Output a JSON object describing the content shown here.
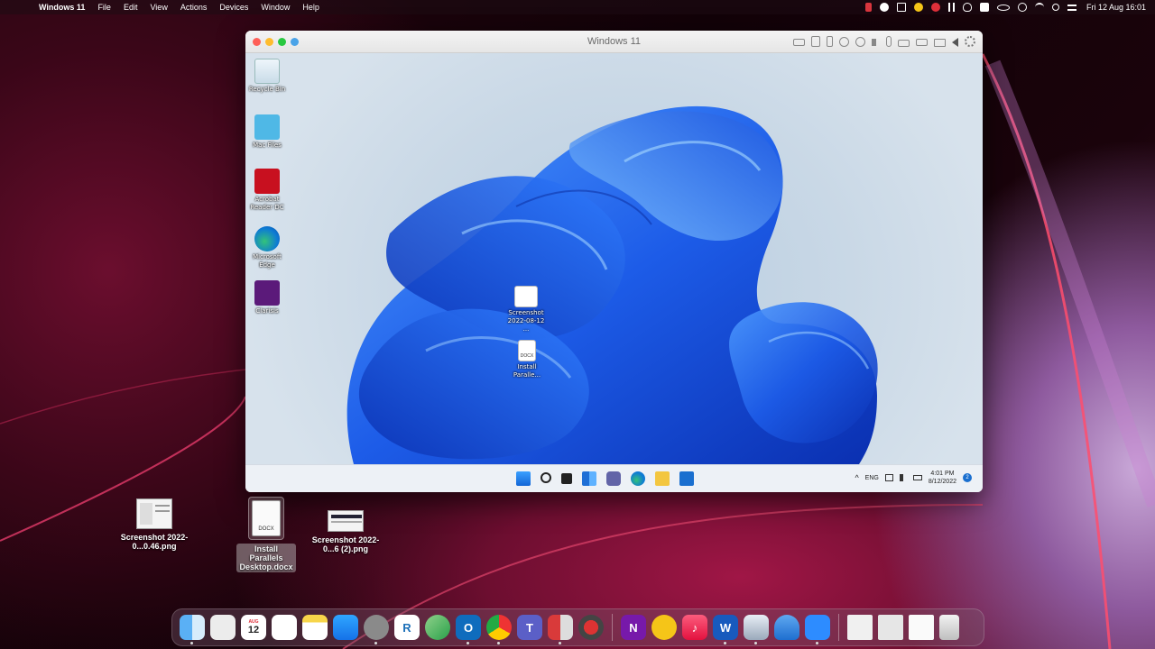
{
  "menubar": {
    "app_name": "Windows 11",
    "items": [
      "File",
      "Edit",
      "View",
      "Actions",
      "Devices",
      "Window",
      "Help"
    ],
    "clock": "Fri 12 Aug  16:01"
  },
  "vm_window": {
    "title": "Windows 11"
  },
  "windows_desktop": {
    "icons": [
      {
        "label": "Recycle Bin"
      },
      {
        "label": "Mac Files"
      },
      {
        "label": "Acrobat Reader DC"
      },
      {
        "label": "Microsoft Edge"
      },
      {
        "label": "Clarisis"
      }
    ],
    "files": [
      {
        "label": "Screenshot 2022-08-12 ..."
      },
      {
        "label": "Install Paralle..."
      }
    ],
    "taskbar": {
      "lang": "ENG",
      "time": "4:01 PM",
      "date": "8/12/2022",
      "notification_count": "2"
    },
    "docx_tag": "DOCX"
  },
  "mac_desktop": {
    "files": [
      {
        "label": "Screenshot 2022-0...0.46.png"
      },
      {
        "label": "Install Parallels Desktop.docx",
        "tag": "DOCX"
      },
      {
        "label": "Screenshot 2022-0...6 (2).png"
      }
    ]
  },
  "dock": {
    "calendar_month": "AUG",
    "calendar_day": "12",
    "icons": [
      "finder-icon",
      "launchpad-icon",
      "calendar-icon",
      "reminders-icon",
      "notes-icon",
      "app-store-icon",
      "system-preferences-icon",
      "rstudio-icon",
      "maps-icon",
      "outlook-icon",
      "chrome-icon",
      "teams-icon",
      "parallels-icon",
      "cherry-icon",
      "onenote-icon",
      "cyberduck-icon",
      "music-icon",
      "word-icon",
      "preview-icon",
      "onedrive-icon",
      "zoom-icon",
      "downloads-stack-icon",
      "documents-stack-icon",
      "screenshots-stack-icon",
      "trash-icon"
    ]
  }
}
